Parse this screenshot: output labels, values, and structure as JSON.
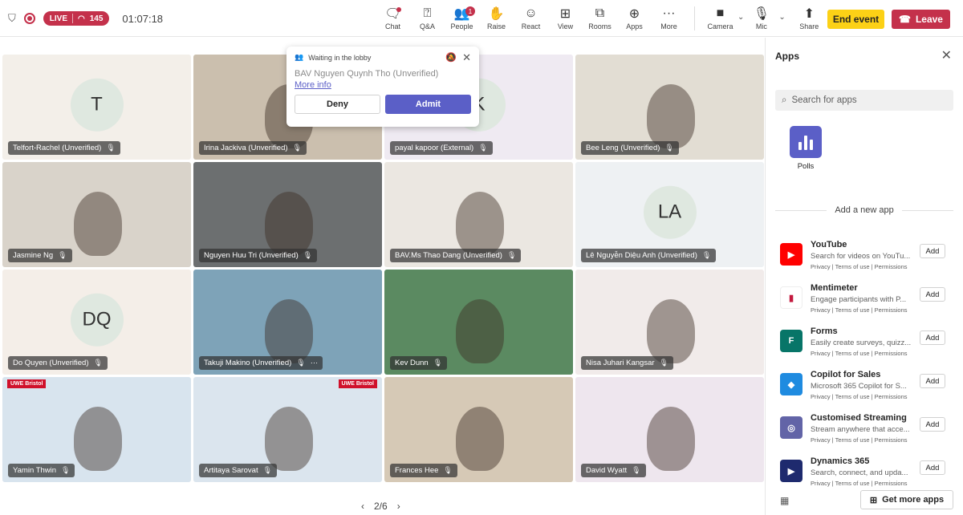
{
  "topbar": {
    "live_label": "LIVE",
    "viewer_count": "145",
    "timer": "01:07:18",
    "tools": [
      {
        "label": "Chat",
        "icon": "chat-icon"
      },
      {
        "label": "Q&A",
        "icon": "qa-icon"
      },
      {
        "label": "People",
        "icon": "people-icon",
        "badge": "1"
      },
      {
        "label": "Raise",
        "icon": "hand-icon"
      },
      {
        "label": "React",
        "icon": "smiley-icon"
      },
      {
        "label": "View",
        "icon": "grid-icon"
      },
      {
        "label": "Rooms",
        "icon": "rooms-icon"
      },
      {
        "label": "Apps",
        "icon": "plus-square-icon"
      },
      {
        "label": "More",
        "icon": "ellipsis-icon"
      }
    ],
    "camera_label": "Camera",
    "mic_label": "Mic",
    "share_label": "Share",
    "end_label": "End event",
    "leave_label": "Leave",
    "colors": {
      "live": "#c4314b",
      "end": "#fcd116",
      "leave": "#c4314b",
      "accent": "#5b5fc7"
    }
  },
  "lobby": {
    "title": "Waiting in the lobby",
    "person": "BAV Nguyen Quynh Tho (Unverified)",
    "more_info": "More info",
    "deny": "Deny",
    "admit": "Admit"
  },
  "tiles": [
    {
      "name": "Telfort-Rachel (Unverified)",
      "initials": "T",
      "bg": "#f3efe9"
    },
    {
      "name": "Irina Jackiva (Unverified)",
      "initials": "",
      "bg": "#cbbfae"
    },
    {
      "name": "payal kapoor (External)",
      "initials": "K",
      "bg": "#efeaf2"
    },
    {
      "name": "Bee Leng (Unverified)",
      "initials": "",
      "bg": "#e2ddd3"
    },
    {
      "name": "Jasmine Ng",
      "initials": "",
      "bg": "#d9d3ca"
    },
    {
      "name": "Nguyen Huu Tri (Unverified)",
      "initials": "",
      "bg": "#6c6f70"
    },
    {
      "name": "BAV.Ms Thao Dang (Unverified)",
      "initials": "",
      "bg": "#ebe7e1"
    },
    {
      "name": "Lê Nguyễn Diệu Anh (Unverified)",
      "initials": "LA",
      "bg": "#eef1f3"
    },
    {
      "name": "Do Quyen (Unverified)",
      "initials": "DQ",
      "bg": "#f4eee8"
    },
    {
      "name": "Takuji Makino (Unverified)",
      "initials": "",
      "bg": "#7ea3b8",
      "more": "···"
    },
    {
      "name": "Kev Dunn",
      "initials": "",
      "bg": "#5b8a61"
    },
    {
      "name": "Nisa Juhari Kangsar",
      "initials": "",
      "bg": "#f1ebea"
    },
    {
      "name": "Yamin Thwin",
      "initials": "",
      "bg": "#d8e4ee",
      "uwe": "UWE Bristol"
    },
    {
      "name": "Artitaya Sarovat",
      "initials": "",
      "bg": "#dbe5ee",
      "uwe": "UWE Bristol"
    },
    {
      "name": "Frances Hee",
      "initials": "",
      "bg": "#d6c9b6"
    },
    {
      "name": "David Wyatt",
      "initials": "",
      "bg": "#eee6ee"
    }
  ],
  "pager": {
    "text": "2/6"
  },
  "apps_panel": {
    "title": "Apps",
    "search_placeholder": "Search for apps",
    "pinned": [
      {
        "label": "Polls"
      }
    ],
    "add_new_label": "Add a new app",
    "links": {
      "privacy": "Privacy",
      "terms": "Terms of use",
      "permissions": "Permissions"
    },
    "add_label": "Add",
    "items": [
      {
        "name": "YouTube",
        "desc": "Search for videos on YouTu...",
        "color": "#ff0000",
        "icon": "youtube-icon",
        "glyph": "▶"
      },
      {
        "name": "Mentimeter",
        "desc": "Engage participants with P...",
        "color": "#ffffff",
        "icon": "mentimeter-icon",
        "glyph": "▮"
      },
      {
        "name": "Forms",
        "desc": "Easily create surveys, quizz...",
        "color": "#077568",
        "icon": "forms-icon",
        "glyph": "F"
      },
      {
        "name": "Copilot for Sales",
        "desc": "Microsoft 365 Copilot for S...",
        "color": "#1f8be0",
        "icon": "copilot-icon",
        "glyph": "◆"
      },
      {
        "name": "Customised Streaming",
        "desc": "Stream anywhere that acce...",
        "color": "#6264a7",
        "icon": "globe-icon",
        "glyph": "◎"
      },
      {
        "name": "Dynamics 365",
        "desc": "Search, connect, and upda...",
        "color": "#1e2a6e",
        "icon": "dynamics-icon",
        "glyph": "▶"
      }
    ],
    "get_more": "Get more apps"
  }
}
